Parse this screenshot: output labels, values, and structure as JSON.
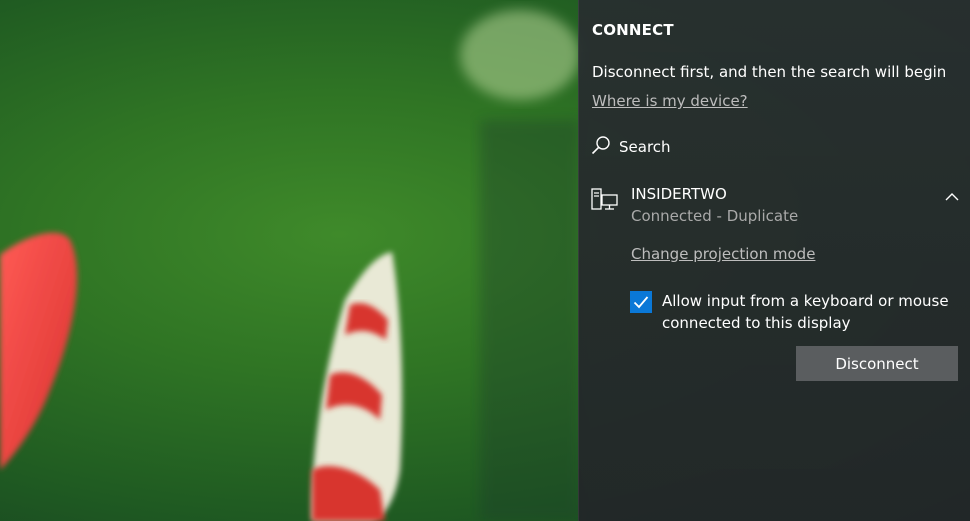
{
  "connect_panel": {
    "title": "CONNECT",
    "status_message": "Disconnect first, and then the search will begin",
    "help_link": "Where is my device?",
    "search_label": "Search",
    "device": {
      "name": "INSIDERTWO",
      "state": "Connected - Duplicate",
      "icon": "display-projection-icon",
      "expanded": true
    },
    "change_mode_link": "Change projection mode",
    "allow_input": {
      "label": "Allow input from a keyboard or mouse connected to this display",
      "checked": true
    },
    "disconnect_label": "Disconnect"
  },
  "colors": {
    "accent": "#0a78d7",
    "panel_bg": "#2a2e31",
    "link": "#bdbdbd",
    "secondary_text": "#a9a9a9",
    "button_bg": "#5a5d5f"
  }
}
